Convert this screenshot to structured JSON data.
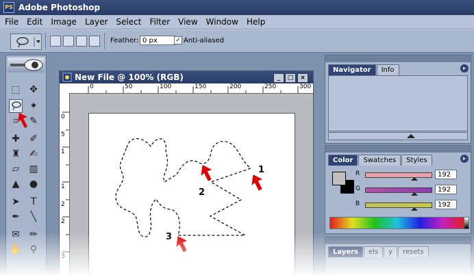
{
  "app_title": "Adobe Photoshop",
  "app_icon": "PS",
  "menu": [
    "File",
    "Edit",
    "Image",
    "Layer",
    "Select",
    "Filter",
    "View",
    "Window",
    "Help"
  ],
  "options": {
    "feather_label": "Feather:",
    "feather_value": "0 px",
    "antialiased_label": "Anti-aliased",
    "antialiased_checked": "✓"
  },
  "document": {
    "title": "New File @ 100% (RGB)",
    "min": "_",
    "max": "□",
    "close": "×",
    "ruler_top": [
      "0",
      "50",
      "100",
      "150",
      "200",
      "250",
      "300"
    ],
    "ruler_left": [
      "0",
      "5",
      "1",
      "1",
      "2",
      "2",
      "3"
    ]
  },
  "navigator_panel": {
    "tabs": [
      "Navigator",
      "Info"
    ],
    "menu": "▸"
  },
  "color_panel": {
    "tabs": [
      "Color",
      "Swatches",
      "Styles"
    ],
    "menu": "▸",
    "channels": [
      {
        "label": "R",
        "value": "192"
      },
      {
        "label": "G",
        "value": "192"
      },
      {
        "label": "B",
        "value": "192"
      }
    ]
  },
  "layers_panel": {
    "tabs": [
      "Layers",
      "els",
      "y",
      "resets"
    ]
  },
  "markers": {
    "one": "1",
    "two": "2",
    "three": "3"
  },
  "colors": {
    "accent": "#2f4474",
    "pointer": "#e10000",
    "r_slider": "#e7a1a8",
    "g_slider": "#8a3bb5",
    "b_slider": "#c9c843"
  }
}
